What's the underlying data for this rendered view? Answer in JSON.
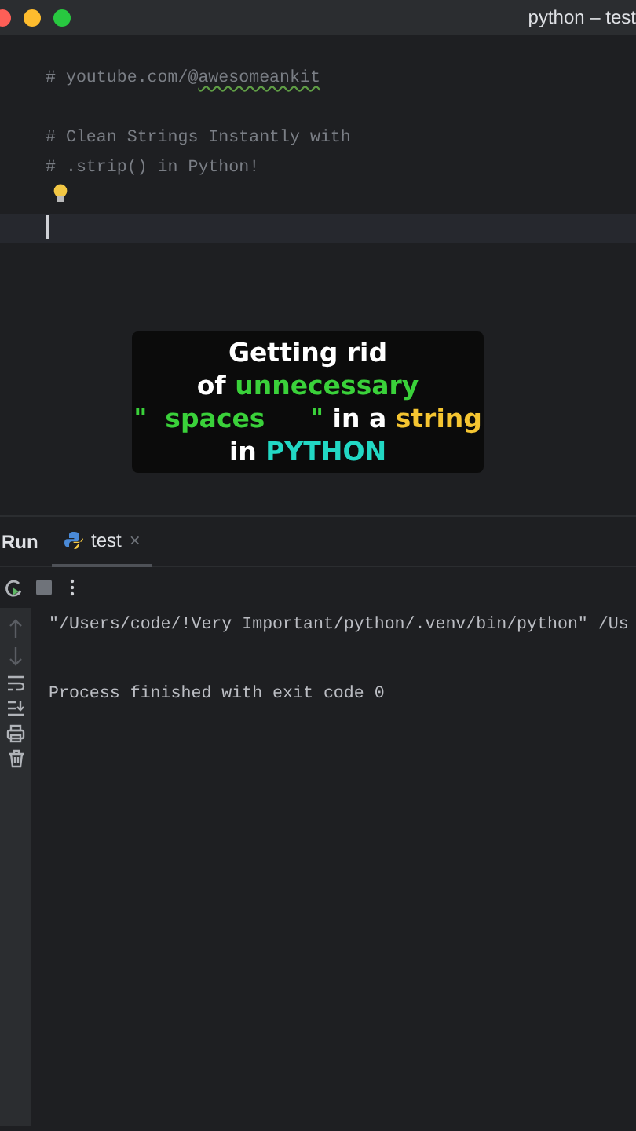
{
  "window": {
    "title": "python – test"
  },
  "editor": {
    "lines": [
      {
        "kind": "comment",
        "text": "# youtube.com/@",
        "underlined": "awesomeankit"
      },
      {
        "kind": "blank"
      },
      {
        "kind": "comment",
        "text": "# Clean Strings Instantly with"
      },
      {
        "kind": "comment",
        "text": "# .strip() in Python!"
      },
      {
        "kind": "bulb"
      },
      {
        "kind": "cursor"
      }
    ]
  },
  "caption": {
    "lines": [
      [
        {
          "text": "Getting rid",
          "color": "#ffffff"
        }
      ],
      [
        {
          "text": "of ",
          "color": "#ffffff"
        },
        {
          "text": "unnecessary",
          "color": "#3ad13a"
        }
      ],
      [
        {
          "text": "\"  spaces     \"",
          "color": "#3ad13a"
        },
        {
          "text": " in a ",
          "color": "#ffffff"
        },
        {
          "text": "string",
          "color": "#f5c531"
        }
      ],
      [
        {
          "text": "in ",
          "color": "#ffffff"
        },
        {
          "text": "PYTHON",
          "color": "#22d8c4"
        }
      ]
    ]
  },
  "run_panel": {
    "title": "Run",
    "tabs": [
      {
        "label": "test",
        "close": "×",
        "selected": true
      }
    ],
    "console": [
      "\"/Users/code/!Very Important/python/.venv/bin/python\" /Us",
      "Process finished with exit code 0"
    ]
  }
}
